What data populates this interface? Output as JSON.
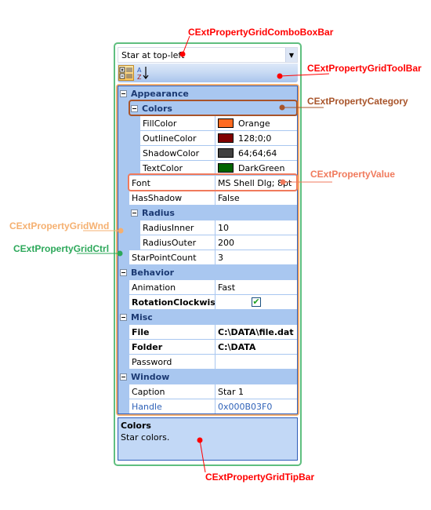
{
  "combo": {
    "value": "Star at top-left"
  },
  "toolbar": {
    "buttons": [
      {
        "name": "categorized",
        "icon": "categorized-icon",
        "active": true
      },
      {
        "name": "alphabetical",
        "icon": "sort-az-icon",
        "active": false
      }
    ]
  },
  "grid": {
    "categories": [
      {
        "label": "Appearance"
      },
      {
        "label": "Colors"
      },
      {
        "label": "Radius"
      },
      {
        "label": "Behavior"
      },
      {
        "label": "Misc"
      },
      {
        "label": "Window"
      }
    ],
    "properties": {
      "fill_color": {
        "name": "FillColor",
        "value": "Orange",
        "swatch": "#ff6a20"
      },
      "outline_color": {
        "name": "OutlineColor",
        "value": "128;0;0",
        "swatch": "#800000"
      },
      "shadow_color": {
        "name": "ShadowColor",
        "value": "64;64;64",
        "swatch": "#404040"
      },
      "text_color": {
        "name": "TextColor",
        "value": "DarkGreen",
        "swatch": "#006400"
      },
      "font": {
        "name": "Font",
        "value": "MS Shell Dlg; 8pt"
      },
      "has_shadow": {
        "name": "HasShadow",
        "value": "False"
      },
      "radius_inner": {
        "name": "RadiusInner",
        "value": "10"
      },
      "radius_outer": {
        "name": "RadiusOuter",
        "value": "200"
      },
      "star_point_count": {
        "name": "StarPointCount",
        "value": "3"
      },
      "animation": {
        "name": "Animation",
        "value": "Fast"
      },
      "rotation_clockwise": {
        "name": "RotationClockwise",
        "checked": true,
        "check_glyph": "✔"
      },
      "file": {
        "name": "File",
        "value": "C:\\DATA\\file.dat"
      },
      "folder": {
        "name": "Folder",
        "value": "C:\\DATA"
      },
      "password": {
        "name": "Password",
        "value": ""
      },
      "caption": {
        "name": "Caption",
        "value": "Star 1"
      },
      "handle": {
        "name": "Handle",
        "value": "0x000B03F0"
      }
    }
  },
  "tipbar": {
    "title": "Colors",
    "description": "Star colors."
  },
  "annotations": {
    "combo_bar": "CExtPropertyGridComboBoxBar",
    "tool_bar": "CExtPropertyGridToolBar",
    "category": "CExtPropertyCategory",
    "value": "CExtPropertyValue",
    "wnd": "CExtPropertyGridWnd",
    "ctrl": "CExtPropertyGridCtrl",
    "tip_bar": "CExtPropertyGridTipBar"
  },
  "colors": {
    "combo_bar": "#ff0000",
    "tool_bar": "#ff0000",
    "category": "#a8542a",
    "value": "#f07a5c",
    "wnd": "#f5b070",
    "ctrl": "#2ca85a",
    "tip_bar": "#ff0000"
  }
}
